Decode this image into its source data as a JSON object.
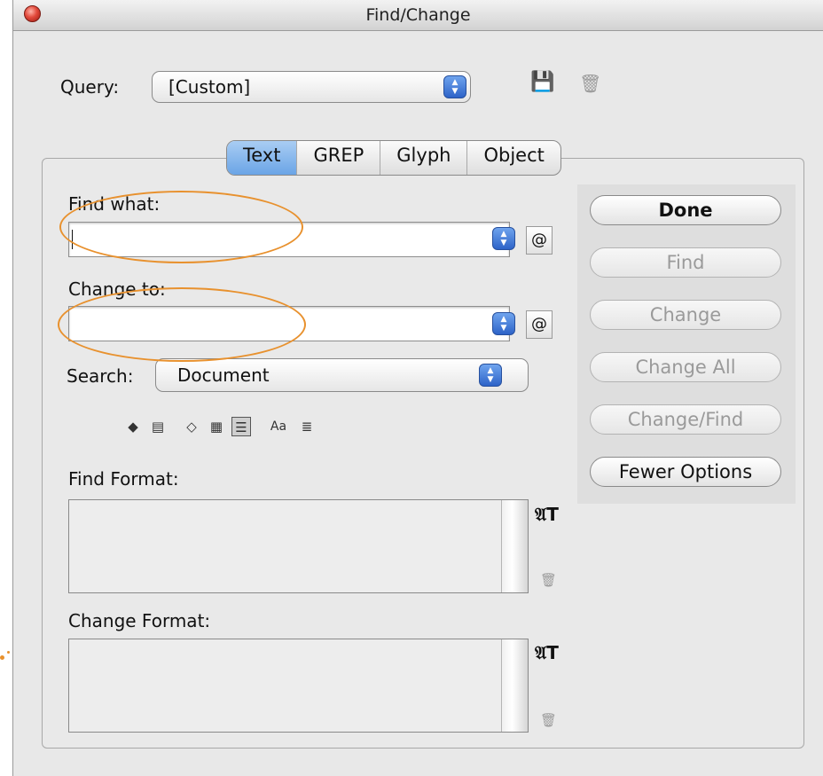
{
  "window": {
    "title": "Find/Change"
  },
  "query": {
    "label": "Query:",
    "value": "[Custom]"
  },
  "tabs": [
    {
      "label": "Text",
      "active": true
    },
    {
      "label": "GREP",
      "active": false
    },
    {
      "label": "Glyph",
      "active": false
    },
    {
      "label": "Object",
      "active": false
    }
  ],
  "find_what": {
    "label": "Find what:",
    "value": ""
  },
  "change_to": {
    "label": "Change to:",
    "value": ""
  },
  "special_char_button": "@",
  "search": {
    "label": "Search:",
    "value": "Document"
  },
  "find_format": {
    "label": "Find Format:"
  },
  "change_format": {
    "label": "Change Format:"
  },
  "buttons": {
    "done": "Done",
    "find": "Find",
    "change": "Change",
    "change_all": "Change All",
    "change_find": "Change/Find",
    "fewer_options": "Fewer Options"
  },
  "colors": {
    "accent": "#2d63c8",
    "annotation": "#e8912e",
    "active_tab": "#6aa4e6"
  },
  "icons": [
    "save-query-icon",
    "delete-query-icon",
    "include-locked-layers-icon",
    "include-locked-stories-icon",
    "include-hidden-layers-icon",
    "include-master-pages-icon",
    "include-footnotes-icon",
    "case-sensitive-icon",
    "whole-word-icon",
    "specify-format-icon",
    "clear-format-icon"
  ]
}
